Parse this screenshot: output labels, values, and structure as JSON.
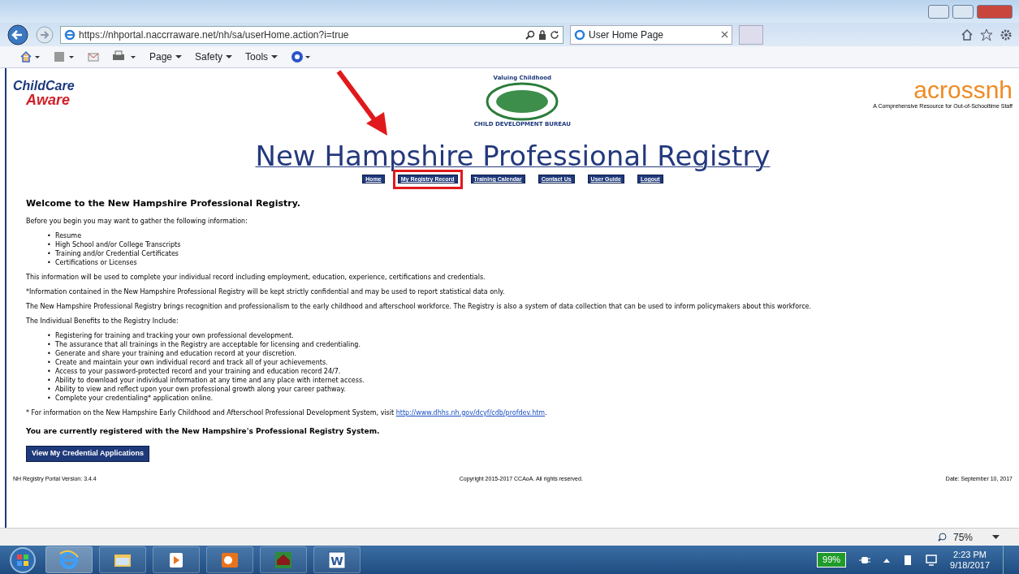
{
  "browser": {
    "address": "https://nhportal.naccrraware.net/nh/sa/userHome.action?i=true",
    "tabs": [
      {
        "title": "User Home Page",
        "selected": true
      }
    ],
    "command_menus": [
      "Page",
      "Safety",
      "Tools"
    ],
    "zoom": "75%"
  },
  "header": {
    "logo_left": {
      "line_1": "ChildCare",
      "line_2": "Aware"
    },
    "logo_center": {
      "top": "Valuing Childhood",
      "bottom": "CHILD DEVELOPMENT BUREAU"
    },
    "logo_right": {
      "name": "acrossnh",
      "tagline": "A Comprehensive Resource for Out-of-Schooltime Staff"
    },
    "title": "New Hampshire Professional Registry",
    "nav": [
      {
        "label": "Home",
        "highlighted": false
      },
      {
        "label": "My Registry Record",
        "highlighted": true
      },
      {
        "label": "Training Calendar",
        "highlighted": false
      },
      {
        "label": "Contact Us",
        "highlighted": false
      },
      {
        "label": "User Guide",
        "highlighted": false
      },
      {
        "label": "Logout",
        "highlighted": false
      }
    ]
  },
  "content": {
    "heading": "Welcome to the New Hampshire Professional Registry.",
    "intro": "Before you begin you may want to gather the following information:",
    "gather_items": [
      {
        "bullet": "•",
        "text": "Resume"
      },
      {
        "bullet": "•",
        "text": "High School and/or College Transcripts"
      },
      {
        "bullet": "•",
        "text": "Training and/or Credential Certificates"
      },
      {
        "bullet": "•",
        "text": "Certifications or Licenses"
      }
    ],
    "paragraphs": [
      "This information will be used to complete your individual record including employment, education, experience, certifications and credentials.",
      "*Information contained in the New Hampshire Professional Registry will be kept strictly confidential and may be used to report statistical data only.",
      "The New Hampshire Professional Registry brings recognition and professionalism to the early childhood and afterschool workforce. The Registry is also a system of data collection that can be used to inform policymakers about this workforce.",
      "The Individual Benefits to the Registry Include:"
    ],
    "benefits": [
      {
        "bullet": "•",
        "text": "Registering for training and tracking your own professional development."
      },
      {
        "bullet": "•",
        "text": "The assurance that all trainings in the Registry are acceptable for licensing and credentialing."
      },
      {
        "bullet": "•",
        "text": "Generate and share your training and education record at your discretion."
      },
      {
        "bullet": "•",
        "text": "Create and maintain your own individual record and track all of your achievements."
      },
      {
        "bullet": "•",
        "text": "Access to your password-protected record and your training and education record 24/7."
      },
      {
        "bullet": "•",
        "text": "Ability to download your individual information at any time and any place with internet access."
      },
      {
        "bullet": "•",
        "text": "Ability to view and reflect upon your own professional growth along your career pathway."
      },
      {
        "bullet": "•",
        "text": "Complete your credentialing* application online."
      }
    ],
    "footnote": {
      "text": "* For information on the New Hampshire Early Childhood and Afterschool Professional Development System, visit",
      "link": "http://www.dhhs.nh.gov/dcyf/cdb/profdev.htm",
      "after": "."
    },
    "registered_notice": "You are currently registered with the New Hampshire's Professional Registry System.",
    "button": "View My Credential Applications"
  },
  "footer": {
    "version": "NH Registry Portal Version: 3.4.4",
    "copyright": "Copyright 2015-2017 CCAoA. All rights reserved.",
    "date": "Date: September 10, 2017"
  },
  "taskbar": {
    "apps": [
      {
        "kind": "browser",
        "active": true
      },
      {
        "kind": "folder",
        "active": false
      },
      {
        "kind": "media",
        "active": false
      },
      {
        "kind": "mail",
        "active": false
      },
      {
        "kind": "barn",
        "active": false
      },
      {
        "kind": "word",
        "active": false,
        "glyph": "W"
      }
    ],
    "battery": "99%",
    "time": "2:23 PM",
    "date": "9/18/2017"
  }
}
